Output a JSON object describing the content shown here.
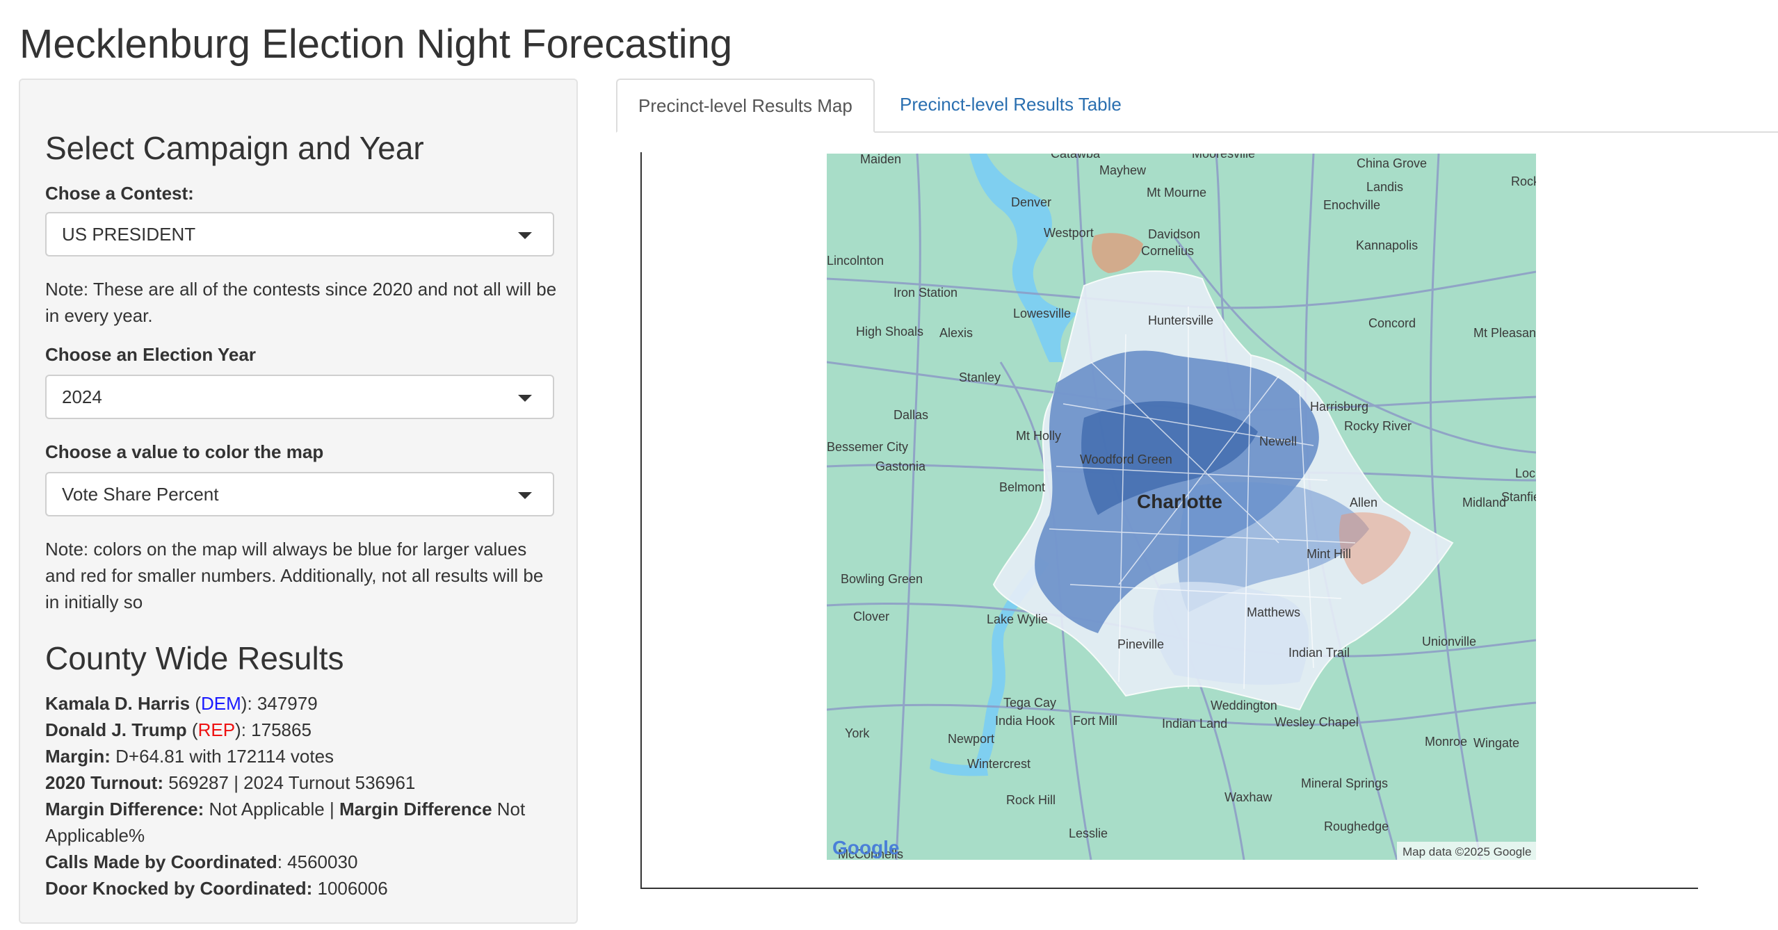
{
  "app": {
    "title": "Mecklenburg Election Night Forecasting"
  },
  "sidebar": {
    "heading": "Select Campaign and Year",
    "contest": {
      "label": "Chose a Contest:",
      "value": "US PRESIDENT"
    },
    "contest_note": "Note: These are all of the contests since 2020 and not all will be in every year.",
    "year": {
      "label": "Choose an Election Year",
      "value": "2024"
    },
    "color_value": {
      "label": "Choose a value to color the map",
      "value": "Vote Share Percent"
    },
    "color_note": "Note: colors on the map will always be blue for larger values and red for smaller numbers. Additionally, not all results will be in initially so",
    "results": {
      "heading": "County Wide Results",
      "candidate1": {
        "name": "Kamala D. Harris",
        "party": "DEM",
        "votes": "347979"
      },
      "candidate2": {
        "name": "Donald J. Trump",
        "party": "REP",
        "votes": "175865"
      },
      "margin_label": "Margin:",
      "margin_value": "D+64.81 with 172114 votes",
      "turnout_label": "2020 Turnout:",
      "turnout_value": "569287 | 2024 Turnout 536961",
      "margin_diff_label": "Margin Difference:",
      "margin_diff_value": "Not Applicable |",
      "margin_diff_label2": "Margin Difference",
      "margin_diff_value2": "Not Applicable%",
      "calls_label": "Calls Made by Coordinated",
      "calls_value": ": 4560030",
      "doors_label": "Door Knocked by Coordinated:",
      "doors_value": "1006006"
    }
  },
  "tabs": [
    {
      "label": "Precinct-level Results Map",
      "active": true
    },
    {
      "label": "Precinct-level Results Table",
      "active": false
    }
  ],
  "map": {
    "places": [
      "Maiden",
      "Mayhew",
      "Mooresville",
      "China Grove",
      "Mt Mourne",
      "Landis",
      "Denver",
      "Enochville",
      "Westport",
      "Davidson",
      "Cornelius",
      "Kannapolis",
      "Lincolnton",
      "Iron Station",
      "Lowesville",
      "Huntersville",
      "Concord",
      "High Shoals",
      "Alexis",
      "Mt Pleasant",
      "Stanley",
      "Harrisburg",
      "Dallas",
      "Mt Holly",
      "Rocky River",
      "Gastonia",
      "Woodford Green",
      "Newell",
      "Belmont",
      "Charlotte",
      "Allen",
      "Midland",
      "Stanfield",
      "Locust",
      "Mint Hill",
      "Bowling Green",
      "Clover",
      "Lake Wylie",
      "Matthews",
      "Unionville",
      "Pineville",
      "Indian Trail",
      "Tega Cay",
      "India Hook",
      "Fort Mill",
      "Indian Land",
      "Weddington",
      "Wesley Chapel",
      "Newport",
      "Wintercrest",
      "Monroe",
      "Wingate",
      "York",
      "Waxhaw",
      "Mineral Springs",
      "Rock Hill",
      "Lesslie",
      "Roughedge",
      "McConnells",
      "Catawba",
      "Rock",
      "Bessemer City"
    ],
    "attribution": "Map data ©2025 Google",
    "logo": "Google",
    "colors": {
      "land": "#a8ddc8",
      "water": "#7fcff0",
      "roads": "#8c9bc6",
      "dem": "#2f62b4",
      "rep": "#e8916c"
    }
  }
}
